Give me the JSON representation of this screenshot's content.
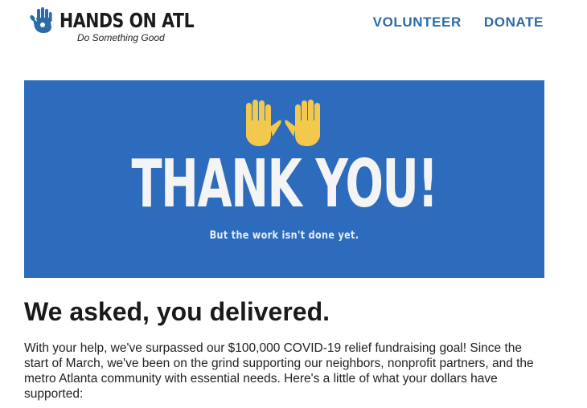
{
  "header": {
    "logo_name": "HANDS ON ATL",
    "logo_tagline": "Do Something Good",
    "nav": [
      {
        "label": "VOLUNTEER"
      },
      {
        "label": "DONATE"
      }
    ]
  },
  "banner": {
    "title": "THANK YOU!",
    "subtitle": "But the work isn't done yet.",
    "background_color": "#2d6cbd",
    "hands_color": "#f2c94c",
    "hands_icon": "raised-hands-icon"
  },
  "main": {
    "headline": "We asked, you delivered.",
    "body": "With your help, we've surpassed our $100,000 COVID-19 relief fundraising goal! Since the start of March, we've been on the grind supporting our neighbors, nonprofit partners, and the metro Atlanta community with essential needs. Here's a little of what your dollars have supported:"
  },
  "colors": {
    "accent": "#2b6ba8",
    "logo_hand": "#2b6ba8"
  }
}
